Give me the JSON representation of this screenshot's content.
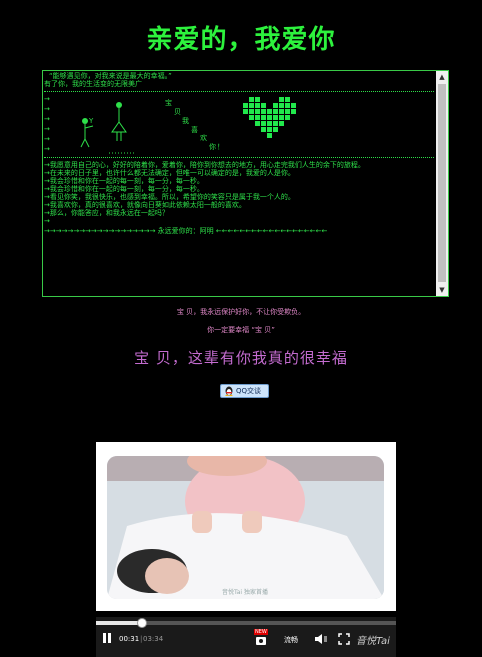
{
  "page": {
    "title": "亲爱的，我爱你"
  },
  "terminal": {
    "quote": "“能够遇见你，对我来说是最大的幸福。”",
    "line2": "有了你，我的生活变的无限美广",
    "arrows": [
      "→",
      "→",
      "→",
      "→",
      "→",
      "→",
      "→",
      "→"
    ],
    "diag_chars": [
      "宝",
      "贝",
      "我",
      "喜",
      "欢",
      "你",
      "！"
    ],
    "fig_label": "Y",
    "letter": [
      "→我愿意用自己的心，好好的陪着你，爱着你，陪你到你想去的地方，用心走完我们人生的余下的旅程。",
      "→在未来的日子里，也许什么都无法确定，但唯一可以确定的是，我爱的人是你。",
      "→我会珍惜和你在一起的每一刻，每一分，每一秒。",
      "→我会珍惜和你在一起的每一刻，每一分，每一秒。",
      "→看见你笑，我很快乐，也感到幸福。所以，希望你的笑容只是属于我一个人的。",
      "→我喜欢你，真的很喜欢，就像向日葵如此依赖太阳一般的喜欢。",
      "→那么，你能答应，和我永远在一起吗？",
      "→"
    ],
    "signature": "→→→→→→→→→→→→→→→→→→→ 永远爱你的：阿明 ←←←←←←←←←←←←←←←←←←←"
  },
  "messages": {
    "line1": "宝 贝，我永远保护好你，不让你受欺负。",
    "line2": "你一定要幸福 “宝 贝”",
    "big": "宝 贝，这辈有你我真的很幸福"
  },
  "qq_button": {
    "label": "QQ交谈"
  },
  "player": {
    "watermark": "音悦Tai 独家首播",
    "current": "00:31",
    "total": "03:34",
    "progress": 0.15,
    "new_badge": "NEW",
    "quality": "流畅",
    "brand": "音悦Tai"
  },
  "colors": {
    "green": "#2df23d",
    "pink": "#e088c8",
    "purple": "#c46cd0"
  }
}
